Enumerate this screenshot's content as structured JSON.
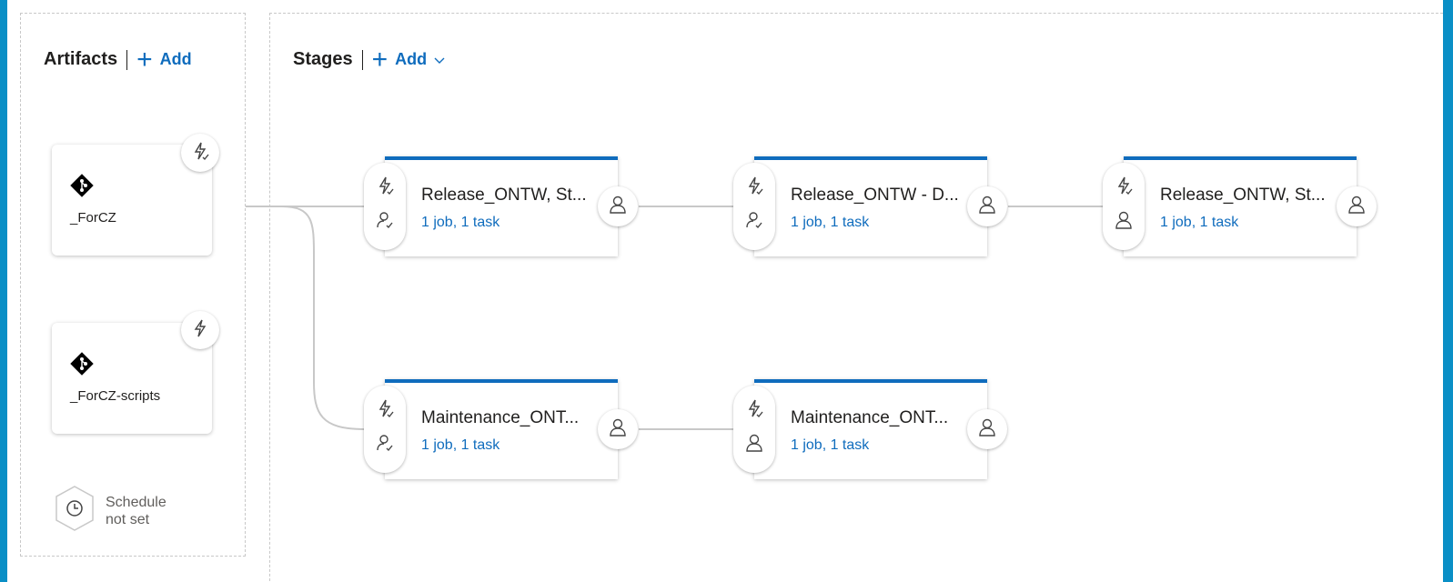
{
  "artifacts_header": {
    "title": "Artifacts",
    "add_label": "Add"
  },
  "stages_header": {
    "title": "Stages",
    "add_label": "Add"
  },
  "artifacts": [
    {
      "name": "_ForCZ",
      "icon": "git-icon",
      "trigger_icon": "continuous-deployment-trigger-icon"
    },
    {
      "name": "_ForCZ-scripts",
      "icon": "git-icon",
      "trigger_icon": "lightning-icon"
    }
  ],
  "schedule": {
    "line1": "Schedule",
    "line2": "not set"
  },
  "stages": [
    {
      "title": "Release_ONTW, St...",
      "subtitle": "1 job, 1 task"
    },
    {
      "title": "Release_ONTW - D...",
      "subtitle": "1 job, 1 task"
    },
    {
      "title": "Release_ONTW, St...",
      "subtitle": "1 job, 1 task"
    },
    {
      "title": "Maintenance_ONT...",
      "subtitle": "1 job, 1 task"
    },
    {
      "title": "Maintenance_ONT...",
      "subtitle": "1 job, 1 task"
    }
  ],
  "colors": {
    "accent": "#0f6cbd",
    "frame": "#0a8fc6"
  }
}
